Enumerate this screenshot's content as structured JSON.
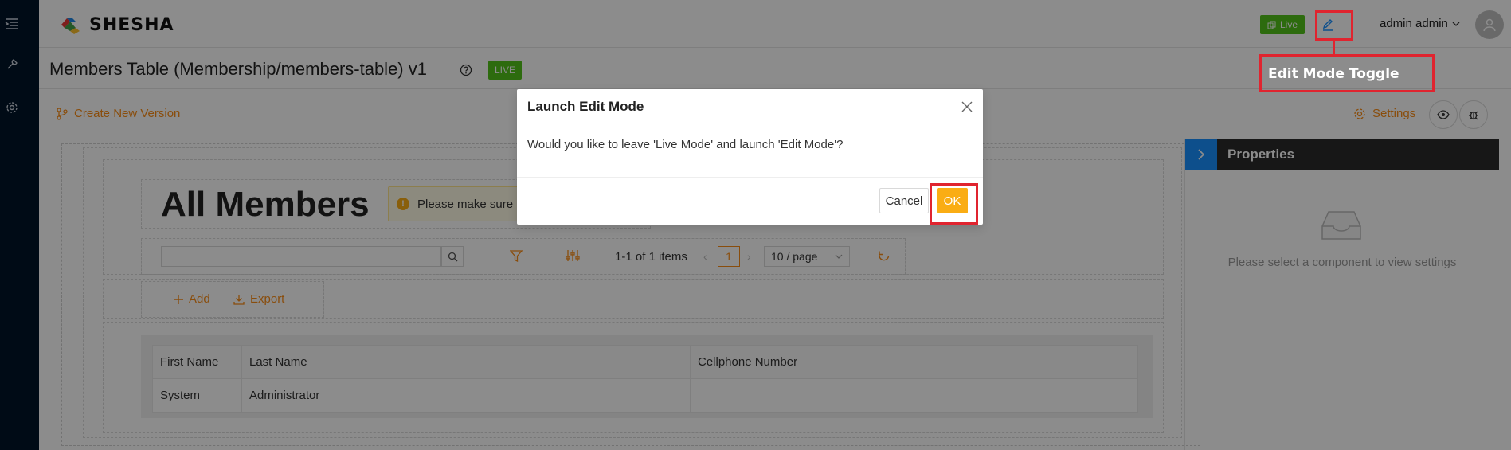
{
  "app": {
    "brand": "SHESHA"
  },
  "header": {
    "live_tag": "Live",
    "user_name": "admin admin"
  },
  "page": {
    "title": "Members Table (Membership/members-table) v1",
    "status_badge": "LIVE"
  },
  "toolbar": {
    "create_version": "Create New Version",
    "settings": "Settings"
  },
  "form": {
    "heading": "All Members",
    "alert_text": "Please make sure t",
    "pager_text": "1-1 of 1 items",
    "current_page": "1",
    "page_size": "10 / page",
    "actions": {
      "add": "Add",
      "export": "Export"
    }
  },
  "table": {
    "columns": [
      "First Name",
      "Last Name",
      "Cellphone Number"
    ],
    "rows": [
      [
        "System",
        "Administrator",
        ""
      ]
    ]
  },
  "properties": {
    "title": "Properties",
    "empty_text": "Please select a component to view settings"
  },
  "modal": {
    "title": "Launch Edit Mode",
    "body": "Would you like to leave 'Live Mode' and launch 'Edit Mode'?",
    "cancel": "Cancel",
    "ok": "OK"
  },
  "annotation": {
    "label": "Edit Mode Toggle",
    "color": "#e0242f"
  },
  "colors": {
    "accent": "#fa8c16",
    "live": "#52c41a",
    "sidebar": "#001529",
    "ok_button": "#faad14"
  }
}
